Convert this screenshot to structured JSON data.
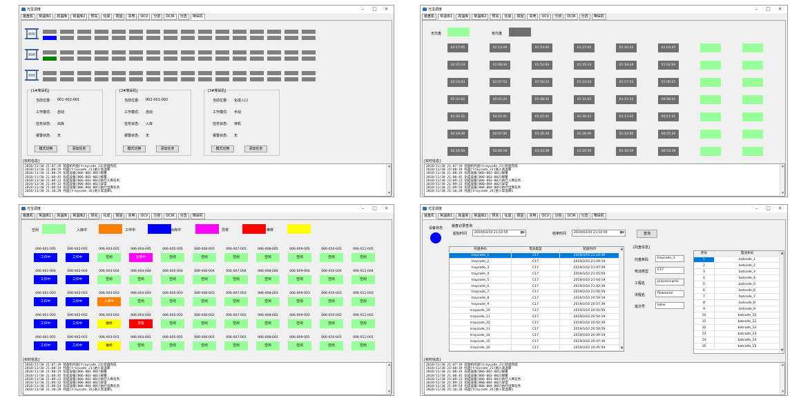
{
  "colors": {
    "occupied": "#6e6e6e",
    "empty": "#99ff99",
    "idle": "#99ff99",
    "inbound": "#ff8000",
    "working": "#0000ff",
    "outbound": "#ff00ff",
    "error": "#ff0000",
    "maintenance": "#ffff00",
    "status_dot": "#0000ff"
  },
  "window_title": "光宝调度",
  "tabs": [
    "装盘机",
    "常温库1",
    "高温库",
    "常温库2",
    "预充",
    "化成",
    "掼固",
    "充电",
    "OCV",
    "分容",
    "DCIR",
    "分选",
    "堆垛机"
  ],
  "log_label": "[实时信息]",
  "log_lines": [
    "2018/11/30 21:07:39 装盘机托盘[traycode_21]装盘完成",
    "2018/11/30 21:08:19 托盘[traycode_21]进入高温库",
    "2018/11/30 21:08:29 化成设备[006-003-001]报警",
    "2018/11/30 21:08:45 化成设备[006-003-002]报警",
    "2018/11/30 21:09:23 化成设备[006-003-003]执行入库任务",
    "2018/11/30 21:09:32 化成设备[006-004-002]异常",
    "2018/11/30 21:09:54 化成设备[006-004-005]执行出库任务",
    "2018/11/30 21:10:28 托盘[traycode_26]进入常温库1"
  ],
  "stacker_page": {
    "slot_highlights": [
      {
        "row": 0,
        "col": 0,
        "color": "#0000ff"
      },
      {
        "row": 1,
        "col": 0,
        "color": "#008000"
      }
    ],
    "stackers": [
      {
        "title": "[1#堆垛机]",
        "pos_label": "当前位置:",
        "pos": "001-002-001",
        "mode_label": "工作模式:",
        "mode": "自动",
        "task_label": "任务状态:",
        "task": "出库",
        "alarm_label": "报警状态:",
        "alarm": "无",
        "btn_mode": "模式切换",
        "btn_task": "添加任务"
      },
      {
        "title": "[2#堆垛机]",
        "pos_label": "当前位置:",
        "pos": "002-001-002",
        "mode_label": "工作模式:",
        "mode": "自动",
        "task_label": "任务状态:",
        "task": "入库",
        "alarm_label": "报警状态:",
        "alarm": "无",
        "btn_mode": "模式切换",
        "btn_task": "添加任务"
      },
      {
        "title": "[3#堆垛机]",
        "pos_label": "当前位置:",
        "pos": "化成入口",
        "mode_label": "工作模式:",
        "mode": "手动",
        "task_label": "任务状态:",
        "task": "待机",
        "alarm_label": "报警状态:",
        "alarm": "无",
        "btn_mode": "模式切换",
        "btn_task": "添加任务"
      }
    ]
  },
  "warehouse_page": {
    "legend_empty": "无托盘",
    "legend_occupied": "有托盘",
    "rows": [
      [
        "02:17:05",
        "02:13:29",
        "01:53:45",
        "01:27:05",
        "01:20:25",
        "01:03:45",
        "",
        ""
      ],
      [
        "02:25:24",
        "02:08:44",
        "01:52:04",
        "01:35:24",
        "01:18:44",
        "01:02:04",
        "",
        ""
      ],
      [
        "02:23:43",
        "02:07:03",
        "01:50:23",
        "01:33:43",
        "01:17:03",
        "01:00:23",
        "",
        ""
      ],
      [
        "02:22:02",
        "02:05:22",
        "01:48:42",
        "01:32:02",
        "01:15:22",
        "00:58:42",
        "",
        ""
      ],
      [
        "02:20:21",
        "02:03:41",
        "01:47:01",
        "01:30:21",
        "01:13:41",
        "00:57:01",
        "",
        ""
      ],
      [
        "02:18:40",
        "02:02:00",
        "01:45:20",
        "01:28:40",
        "01:12:00",
        "00:55:20",
        "",
        ""
      ],
      [
        "02:16:59",
        "02:00:19",
        "01:43:39",
        "01:26:59",
        "01:10:19",
        "00:53:39",
        "",
        ""
      ]
    ]
  },
  "formation_page": {
    "legend": [
      {
        "label": "空闲",
        "color": "#99ff99"
      },
      {
        "label": "入库中",
        "color": "#ff8000"
      },
      {
        "label": "工作中",
        "color": "#0000ff"
      },
      {
        "label": "出库中",
        "color": "#ff00ff"
      },
      {
        "label": "异常",
        "color": "#ff0000"
      },
      {
        "label": "维修",
        "color": "#ffff00"
      }
    ],
    "rows": [
      {
        "ids": [
          "006-001-005",
          "006-002-005",
          "006-003-005",
          "006-004-005",
          "006-005-005",
          "006-006-005",
          "006-007-005",
          "006-008-005",
          "006-009-005",
          "006-010-005",
          "006-011-005"
        ],
        "status": [
          "工作中",
          "工作中",
          "空闲",
          "出库中",
          "空闲",
          "空闲",
          "空闲",
          "空闲",
          "空闲",
          "空闲",
          "空闲"
        ],
        "colors": [
          "#0000ff",
          "#0000ff",
          "#99ff99",
          "#ff00ff",
          "#99ff99",
          "#99ff99",
          "#99ff99",
          "#99ff99",
          "#99ff99",
          "#99ff99",
          "#99ff99"
        ]
      },
      {
        "ids": [
          "006-001-004",
          "006-002-004",
          "006-003-004",
          "006-004-004",
          "006-005-004",
          "006-006-004",
          "006-007-004",
          "006-008-004",
          "006-009-004",
          "006-010-004",
          "006-011-004"
        ],
        "status": [
          "工作中",
          "工作中",
          "空闲",
          "空闲",
          "空闲",
          "空闲",
          "空闲",
          "空闲",
          "空闲",
          "空闲",
          "空闲"
        ],
        "colors": [
          "#0000ff",
          "#0000ff",
          "#99ff99",
          "#99ff99",
          "#99ff99",
          "#99ff99",
          "#99ff99",
          "#99ff99",
          "#99ff99",
          "#99ff99",
          "#99ff99"
        ]
      },
      {
        "ids": [
          "006-001-003",
          "006-002-003",
          "006-003-003",
          "006-004-003",
          "006-005-003",
          "006-006-003",
          "006-007-003",
          "006-008-003",
          "006-009-003",
          "006-010-003",
          "006-011-003"
        ],
        "status": [
          "工作中",
          "工作中",
          "入库中",
          "空闲",
          "空闲",
          "空闲",
          "空闲",
          "空闲",
          "空闲",
          "空闲",
          "空闲"
        ],
        "colors": [
          "#0000ff",
          "#0000ff",
          "#ff8000",
          "#99ff99",
          "#99ff99",
          "#99ff99",
          "#99ff99",
          "#99ff99",
          "#99ff99",
          "#99ff99",
          "#99ff99"
        ]
      },
      {
        "ids": [
          "006-001-002",
          "006-002-002",
          "006-003-002",
          "006-004-002",
          "006-005-002",
          "006-006-002",
          "006-007-002",
          "006-008-002",
          "006-009-002",
          "006-010-002",
          "006-011-002"
        ],
        "status": [
          "工作中",
          "工作中",
          "维修",
          "异常",
          "空闲",
          "空闲",
          "空闲",
          "空闲",
          "空闲",
          "空闲",
          "空闲"
        ],
        "colors": [
          "#0000ff",
          "#0000ff",
          "#ffff00",
          "#ff0000",
          "#99ff99",
          "#99ff99",
          "#99ff99",
          "#99ff99",
          "#99ff99",
          "#99ff99",
          "#99ff99"
        ]
      },
      {
        "ids": [
          "006-001-001",
          "006-002-001",
          "006-003-001",
          "006-004-001",
          "006-005-001",
          "006-006-001",
          "006-007-001",
          "006-008-001",
          "006-009-001",
          "006-010-001",
          "006-011-001"
        ],
        "status": [
          "工作中",
          "工作中",
          "维修",
          "空闲",
          "空闲",
          "空闲",
          "空闲",
          "空闲",
          "空闲",
          "空闲",
          "空闲"
        ],
        "colors": [
          "#0000ff",
          "#0000ff",
          "#ffff00",
          "#99ff99",
          "#99ff99",
          "#99ff99",
          "#99ff99",
          "#99ff99",
          "#99ff99",
          "#99ff99",
          "#99ff99"
        ]
      }
    ]
  },
  "loader_page": {
    "status_label": "设备状态",
    "query_title": "装盘记录查询",
    "start_label": "起始时间",
    "start_value": "2019/03/10 21:10:59",
    "end_label": "结束时间",
    "end_value": "2019/03/10 21:10:59",
    "query_button": "查询",
    "table_headers": [
      "托盘条码",
      "电池类型",
      "装盘时间"
    ],
    "table_rows": [
      [
        "traycode_1",
        "C17",
        "2019/3/10 21:10:59"
      ],
      [
        "traycode_2",
        "C17",
        "2019/3/10 21:09:19"
      ],
      [
        "traycode_3",
        "C17",
        "2019/3/10 21:07:39"
      ],
      [
        "traycode_4",
        "C17",
        "2019/3/10 21:05:59"
      ],
      [
        "traycode_5",
        "C17",
        "2019/3/10 21:04:19"
      ],
      [
        "traycode_6",
        "C17",
        "2019/3/10 21:02:39"
      ],
      [
        "traycode_7",
        "C17",
        "2019/3/10 21:00:59"
      ],
      [
        "traycode_8",
        "C17",
        "2019/3/10 20:59:19"
      ],
      [
        "traycode_9",
        "C17",
        "2019/3/10 20:57:39"
      ],
      [
        "traycode_10",
        "C17",
        "2019/3/10 20:55:59"
      ],
      [
        "traycode_11",
        "C17",
        "2019/3/10 20:54:19"
      ],
      [
        "traycode_12",
        "C17",
        "2019/3/10 20:52:39"
      ],
      [
        "traycode_13",
        "C17",
        "2019/3/10 20:50:59"
      ],
      [
        "traycode_14",
        "C17",
        "2019/3/10 20:49:19"
      ],
      [
        "traycode_15",
        "C17",
        "2019/3/10 20:47:39"
      ],
      [
        "traycode_16",
        "C17",
        "2019/3/10 20:45:59"
      ]
    ],
    "detail_title": "[托盘信息]",
    "detail_fields": [
      {
        "label": "托盘条码",
        "value": "traycode_3"
      },
      {
        "label": "电池类型",
        "value": "C17"
      },
      {
        "label": "工程名",
        "value": "processname"
      },
      {
        "label": "流程名",
        "value": "flowname"
      },
      {
        "label": "批次号",
        "value": "lotno"
      }
    ],
    "battery_headers": [
      "序号",
      "电池条码"
    ],
    "battery_rows": [
      [
        "1",
        "batcode_1"
      ],
      [
        "2",
        "batcode_2"
      ],
      [
        "3",
        "batcode_3"
      ],
      [
        "4",
        "batcode_4"
      ],
      [
        "5",
        "batcode_5"
      ],
      [
        "6",
        "batcode_6"
      ],
      [
        "7",
        "batcode_7"
      ],
      [
        "8",
        "batcode_8"
      ],
      [
        "9",
        "batcode_9"
      ],
      [
        "10",
        "batcode_10"
      ],
      [
        "11",
        "batcode_11"
      ],
      [
        "12",
        "batcode_12"
      ],
      [
        "13",
        "batcode_13"
      ],
      [
        "14",
        "batcode_14"
      ],
      [
        "15",
        "batcode_15"
      ]
    ]
  }
}
